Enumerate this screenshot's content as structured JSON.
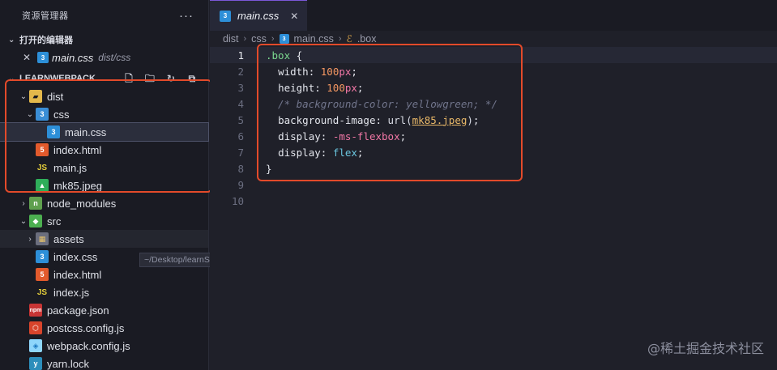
{
  "explorer": {
    "title": "资源管理器",
    "more": "···",
    "open_editors_label": "打开的编辑器",
    "open_editor": {
      "name": "main.css",
      "path": "dist/css"
    },
    "project_label": "LEARNWEBPACK"
  },
  "tree": [
    {
      "name": "dist",
      "icon": "folder-dist-icon",
      "chev": "⌄",
      "indent": 0
    },
    {
      "name": "css",
      "icon": "folder-css-icon",
      "chev": "⌄",
      "indent": 1
    },
    {
      "name": "main.css",
      "icon": "css-file-icon",
      "chev": "",
      "indent": 2
    },
    {
      "name": "index.html",
      "icon": "html-file-icon",
      "chev": "",
      "indent": 1
    },
    {
      "name": "main.js",
      "icon": "js-file-icon",
      "chev": "",
      "indent": 1
    },
    {
      "name": "mk85.jpeg",
      "icon": "image-file-icon",
      "chev": "",
      "indent": 1
    },
    {
      "name": "node_modules",
      "icon": "folder-node-icon",
      "chev": "›",
      "indent": 0
    },
    {
      "name": "src",
      "icon": "folder-src-icon",
      "chev": "⌄",
      "indent": 0
    },
    {
      "name": "assets",
      "icon": "folder-assets-icon",
      "chev": "›",
      "indent": 1
    },
    {
      "name": "index.css",
      "icon": "css-file-icon",
      "chev": "",
      "indent": 1
    },
    {
      "name": "index.html",
      "icon": "html-file-icon",
      "chev": "",
      "indent": 1
    },
    {
      "name": "index.js",
      "icon": "js-file-icon",
      "chev": "",
      "indent": 1
    },
    {
      "name": "package.json",
      "icon": "npm-icon",
      "chev": "",
      "indent": 0
    },
    {
      "name": "postcss.config.js",
      "icon": "postcss-icon",
      "chev": "",
      "indent": 0
    },
    {
      "name": "webpack.config.js",
      "icon": "webpack-icon",
      "chev": "",
      "indent": 0
    },
    {
      "name": "yarn.lock",
      "icon": "yarn-icon",
      "chev": "",
      "indent": 0
    }
  ],
  "tooltip": "~/Desktop/learnSpace/learnWebpack/src/assets",
  "tab": {
    "label": "main.css",
    "close": "✕"
  },
  "breadcrumb": {
    "p1": "dist",
    "p2": "css",
    "p3": "main.css",
    "p4": ".box"
  },
  "code_lines": [
    {
      "n": "1",
      "text": ".box {"
    },
    {
      "n": "2",
      "text": "  width: 100px;"
    },
    {
      "n": "3",
      "text": "  height: 100px;"
    },
    {
      "n": "4",
      "text": "  /* background-color: yellowgreen; */"
    },
    {
      "n": "5",
      "text": "  background-image: url(mk85.jpeg);"
    },
    {
      "n": "6",
      "text": "  display: -ms-flexbox;"
    },
    {
      "n": "7",
      "text": "  display: flex;"
    },
    {
      "n": "8",
      "text": "}"
    },
    {
      "n": "9",
      "text": ""
    },
    {
      "n": "10",
      "text": ""
    }
  ],
  "watermark": "@稀土掘金技术社区",
  "colors": {
    "highlight_box": "#e34a2a",
    "accent": "#7b57d8"
  }
}
